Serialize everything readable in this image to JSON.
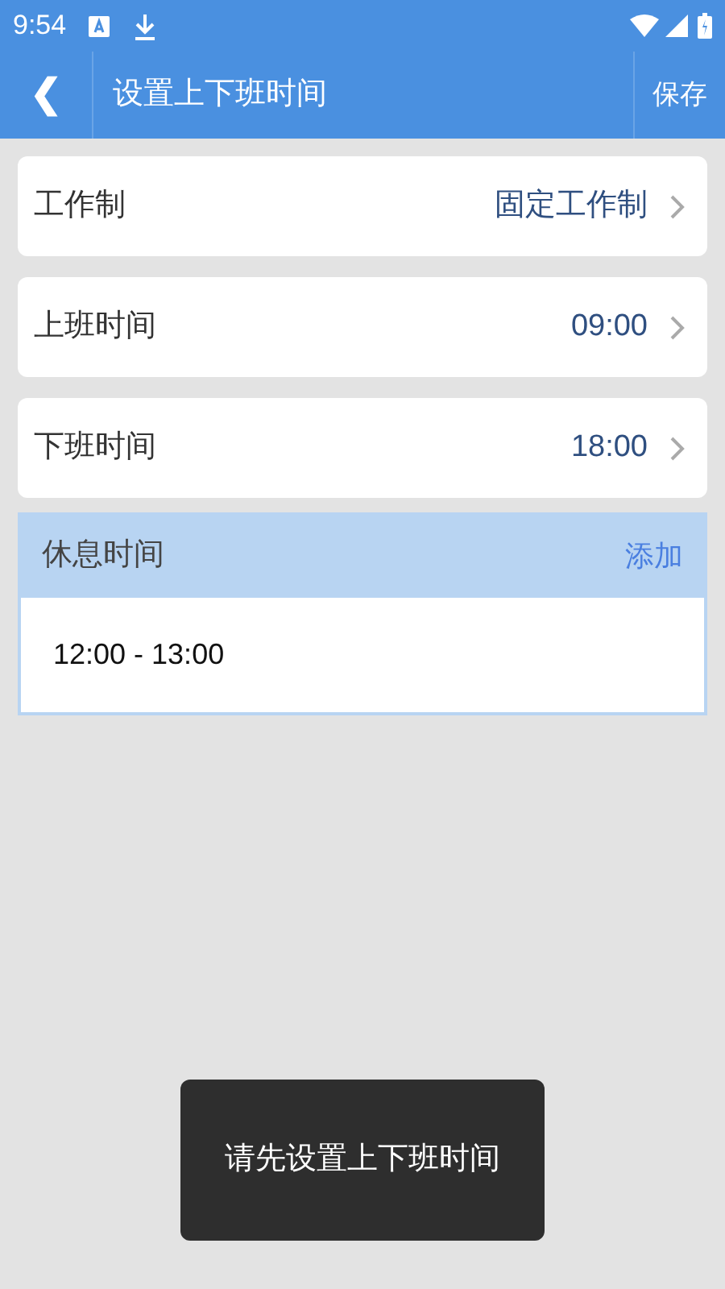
{
  "status_bar": {
    "time": "9:54"
  },
  "header": {
    "back": "❮",
    "title": "设置上下班时间",
    "action": "保存"
  },
  "settings": [
    {
      "label": "工作制",
      "value": "固定工作制"
    },
    {
      "label": "上班时间",
      "value": "09:00"
    },
    {
      "label": "下班时间",
      "value": "18:00"
    }
  ],
  "break_section": {
    "title": "休息时间",
    "action": "添加",
    "items": [
      "12:00 - 13:00"
    ]
  },
  "toast": {
    "text": "请先设置上下班时间"
  }
}
